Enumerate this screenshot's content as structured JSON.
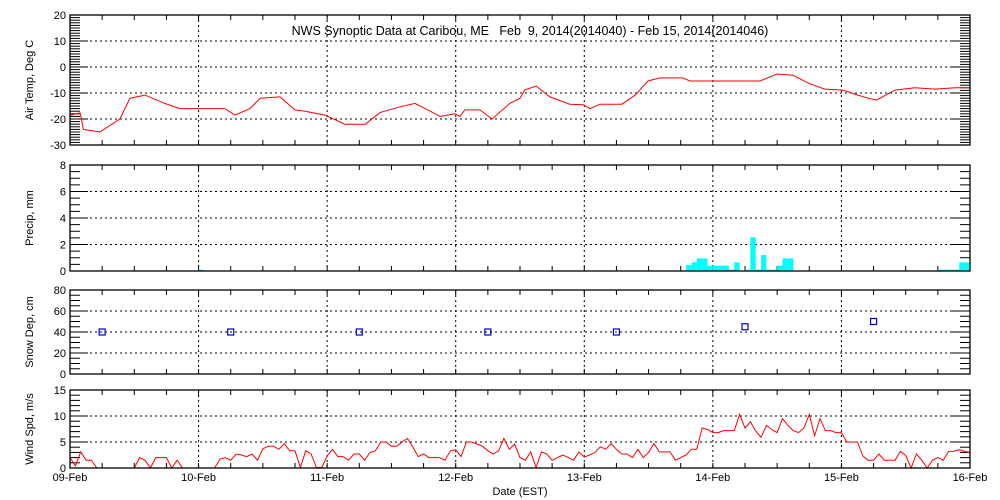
{
  "chart_data": [
    {
      "type": "line",
      "id": "temp",
      "title": "NWS Synoptic Data at Caribou, ME   Feb  9, 2014(2014040) - Feb 15, 2014(2014046)",
      "ylabel": "Air Temp, Deg C",
      "ylim": [
        -30,
        20
      ],
      "yticks": [
        -30,
        -20,
        -10,
        0,
        10,
        20
      ],
      "ytick_labels": [
        "-30",
        "-20",
        "-10",
        "0",
        "10",
        "20"
      ],
      "minor_step": 1,
      "grid": true,
      "color": "#ff0000",
      "x_units": "hours since 09-Feb 00:00 EST",
      "points": [
        [
          0,
          -18.5
        ],
        [
          1.9,
          -17.7
        ],
        [
          2.5,
          -24
        ],
        [
          5.6,
          -25
        ],
        [
          9.3,
          -20
        ],
        [
          11.2,
          -12
        ],
        [
          14,
          -10.8
        ],
        [
          17.7,
          -14
        ],
        [
          20.5,
          -16
        ],
        [
          24.3,
          -16
        ],
        [
          28.9,
          -16
        ],
        [
          30.8,
          -18.5
        ],
        [
          33.6,
          -16
        ],
        [
          35.5,
          -12
        ],
        [
          39.2,
          -11.5
        ],
        [
          42,
          -16.5
        ],
        [
          43.9,
          -17
        ],
        [
          47.6,
          -18.5
        ],
        [
          51.3,
          -22
        ],
        [
          55.1,
          -22
        ],
        [
          57.9,
          -17.5
        ],
        [
          61.6,
          -15.3
        ],
        [
          64.4,
          -14
        ],
        [
          66.3,
          -16
        ],
        [
          69.1,
          -19
        ],
        [
          71.9,
          -18
        ],
        [
          72.8,
          -19
        ],
        [
          73.7,
          -16.5
        ],
        [
          76.5,
          -16.5
        ],
        [
          78.8,
          -20
        ],
        [
          82.1,
          -14
        ],
        [
          84,
          -12
        ],
        [
          84.9,
          -8.8
        ],
        [
          87,
          -7.3
        ],
        [
          89.6,
          -11.5
        ],
        [
          93.3,
          -14.3
        ],
        [
          95.8,
          -14.5
        ],
        [
          97.1,
          -16
        ],
        [
          98.9,
          -14.3
        ],
        [
          103,
          -14.3
        ],
        [
          105.5,
          -10.8
        ],
        [
          107.9,
          -5.4
        ],
        [
          110.1,
          -4.2
        ],
        [
          114.4,
          -4.2
        ],
        [
          115.7,
          -5.4
        ],
        [
          128.8,
          -5.4
        ],
        [
          132,
          -2.7
        ],
        [
          135,
          -3.2
        ],
        [
          137.8,
          -6.2
        ],
        [
          140.9,
          -8.5
        ],
        [
          144.3,
          -8.9
        ],
        [
          147.1,
          -10.8
        ],
        [
          149,
          -12
        ],
        [
          150.6,
          -12.7
        ],
        [
          154,
          -8.9
        ],
        [
          157.7,
          -8
        ],
        [
          161.5,
          -8.5
        ],
        [
          165.2,
          -8
        ],
        [
          168,
          -8
        ]
      ]
    },
    {
      "type": "bar",
      "id": "precip",
      "ylabel": "Precip, mm",
      "ylim": [
        0,
        8
      ],
      "yticks": [
        0,
        2,
        4,
        6,
        8
      ],
      "ytick_labels": [
        "0",
        "2",
        "4",
        "6",
        "8"
      ],
      "minor_step": 0.5,
      "grid": true,
      "color": "#00ffff",
      "x_units": "hour starting, since 09-Feb 00:00 EST (1-hour bars)",
      "points": [
        [
          24,
          0.1
        ],
        [
          115,
          0.45
        ],
        [
          116,
          0.65
        ],
        [
          117,
          0.95
        ],
        [
          118,
          0.95
        ],
        [
          119,
          0.4
        ],
        [
          120,
          0.4
        ],
        [
          121,
          0.4
        ],
        [
          122,
          0.4
        ],
        [
          123,
          0.1
        ],
        [
          124,
          0.65
        ],
        [
          126,
          0.1
        ],
        [
          127,
          2.55
        ],
        [
          128,
          0.1
        ],
        [
          129,
          1.2
        ],
        [
          130,
          0.1
        ],
        [
          131,
          0.1
        ],
        [
          132,
          0.4
        ],
        [
          133,
          0.95
        ],
        [
          134,
          0.95
        ],
        [
          162,
          0.1
        ],
        [
          163,
          0.1
        ],
        [
          164,
          0.1
        ],
        [
          165,
          0.1
        ],
        [
          166,
          0.65
        ],
        [
          167,
          0.65
        ]
      ]
    },
    {
      "type": "scatter",
      "id": "snow",
      "ylabel": "Snow Dep, cm",
      "ylim": [
        0,
        80
      ],
      "yticks": [
        0,
        20,
        40,
        60,
        80
      ],
      "ytick_labels": [
        "0",
        "20",
        "40",
        "60",
        "80"
      ],
      "minor_step": 5,
      "grid": true,
      "color": "#0000cc",
      "x_units": "hours since 09-Feb 00:00 EST",
      "points": [
        [
          6,
          40
        ],
        [
          30,
          40
        ],
        [
          54,
          40
        ],
        [
          78,
          40
        ],
        [
          102,
          40
        ],
        [
          126,
          45
        ],
        [
          150,
          50
        ]
      ]
    },
    {
      "type": "line",
      "id": "wind",
      "ylabel": "Wind Spd, m/s",
      "ylim": [
        0,
        15
      ],
      "yticks": [
        0,
        5,
        10,
        15
      ],
      "ytick_labels": [
        "0",
        "5",
        "10",
        "15"
      ],
      "minor_step": 1,
      "grid": true,
      "color": "#ff0000",
      "x_units": "hourly values starting 09-Feb 00:00 EST",
      "values": [
        2,
        0.4,
        3.1,
        1.5,
        1.5,
        0,
        0,
        0,
        0,
        0,
        0,
        0,
        0,
        2,
        1.5,
        0,
        2,
        2,
        2,
        0,
        1.5,
        0,
        0,
        0,
        0,
        0,
        0,
        0,
        1.7,
        2,
        1.5,
        2.7,
        2.5,
        2.2,
        2.7,
        1.5,
        3.7,
        4.2,
        4.2,
        3.6,
        4.7,
        3.3,
        3.3,
        0.1,
        3.3,
        2.7,
        0.1,
        0.1,
        2.3,
        3.6,
        2.2,
        2.2,
        1.5,
        2.7,
        2.7,
        1.5,
        3,
        3.3,
        5,
        5,
        4.2,
        4.2,
        5,
        5.7,
        4,
        2.2,
        2.7,
        2,
        2,
        2,
        1.5,
        3.3,
        3.5,
        2.2,
        5,
        5,
        4.6,
        4.2,
        3.3,
        2.7,
        3.3,
        5.7,
        3.6,
        4.6,
        2,
        1.5,
        3.1,
        0.1,
        3.1,
        2.7,
        1.5,
        2,
        2.5,
        2,
        1.5,
        3.1,
        2.1,
        2.5,
        3,
        4.1,
        3.6,
        4.7,
        3.6,
        2.7,
        2.7,
        2,
        3.6,
        2,
        3,
        4.7,
        3.1,
        3.1,
        3.1,
        1.5,
        2,
        2.5,
        3.6,
        3.6,
        7.7,
        7.4,
        6.8,
        6.8,
        7.2,
        7.2,
        7.2,
        10.3,
        7.7,
        8.9,
        7.1,
        5.9,
        8.2,
        7.4,
        6.8,
        9.5,
        8.2,
        7.2,
        6.8,
        7.7,
        10.3,
        6.2,
        9.5,
        7.2,
        7.2,
        6.8,
        6.8,
        5,
        5,
        5,
        2.3,
        1.5,
        1.5,
        2.7,
        1.5,
        1.5,
        1.5,
        3.2,
        2.4,
        0,
        2.7,
        1.5,
        0,
        1.5,
        2,
        1.5,
        3.2,
        3.2,
        3.5,
        3.2,
        3
      ]
    }
  ],
  "x_axis": {
    "label": "Date (EST)",
    "range_hours": [
      0,
      168
    ],
    "tick_labels": [
      "09-Feb",
      "10-Feb",
      "11-Feb",
      "12-Feb",
      "13-Feb",
      "14-Feb",
      "15-Feb",
      "16-Feb"
    ]
  }
}
